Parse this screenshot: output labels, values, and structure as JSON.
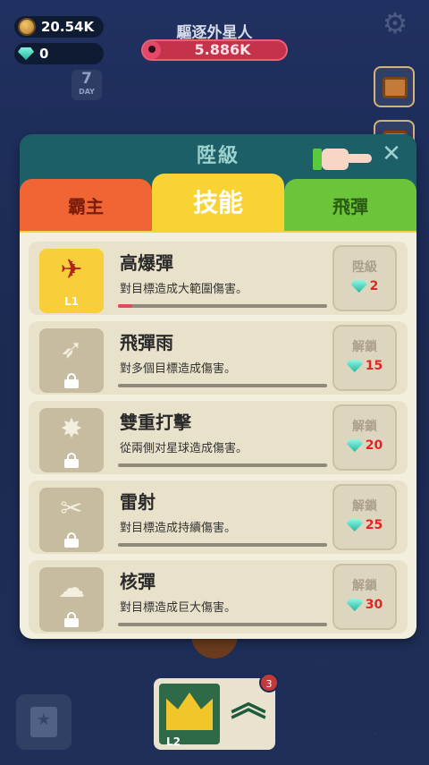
{
  "hud": {
    "coins": "20.54K",
    "gems": "0",
    "mission_title": "驅逐外星人",
    "mission_value": "5.886K",
    "day_number": "7",
    "day_label": "DAY"
  },
  "modal": {
    "title": "陞級",
    "tabs": [
      "霸主",
      "技能",
      "飛彈"
    ],
    "active_tab": "技能",
    "skills": [
      {
        "name": "高爆彈",
        "desc": "對目標造成大範圍傷害。",
        "action": "陞級",
        "cost": "2",
        "level": "L1",
        "unlocked": true,
        "progress": 0.07
      },
      {
        "name": "飛彈雨",
        "desc": "對多個目標造成傷害。",
        "action": "解鎖",
        "cost": "15",
        "unlocked": false,
        "progress": 0
      },
      {
        "name": "雙重打擊",
        "desc": "從兩側对星球造成傷害。",
        "action": "解鎖",
        "cost": "20",
        "unlocked": false,
        "progress": 0
      },
      {
        "name": "雷射",
        "desc": "對目標造成持續傷害。",
        "action": "解鎖",
        "cost": "25",
        "unlocked": false,
        "progress": 0
      },
      {
        "name": "核彈",
        "desc": "對目標造成巨大傷害。",
        "action": "解鎖",
        "cost": "30",
        "unlocked": false,
        "progress": 0
      }
    ]
  },
  "bottom": {
    "level_label": "L2",
    "notification_count": "3"
  },
  "colors": {
    "tab_overlord": "#f16434",
    "tab_skill": "#f8d334",
    "tab_missile": "#6cc43a",
    "cost_red": "#e02525",
    "modal_header": "#1d5f66"
  }
}
